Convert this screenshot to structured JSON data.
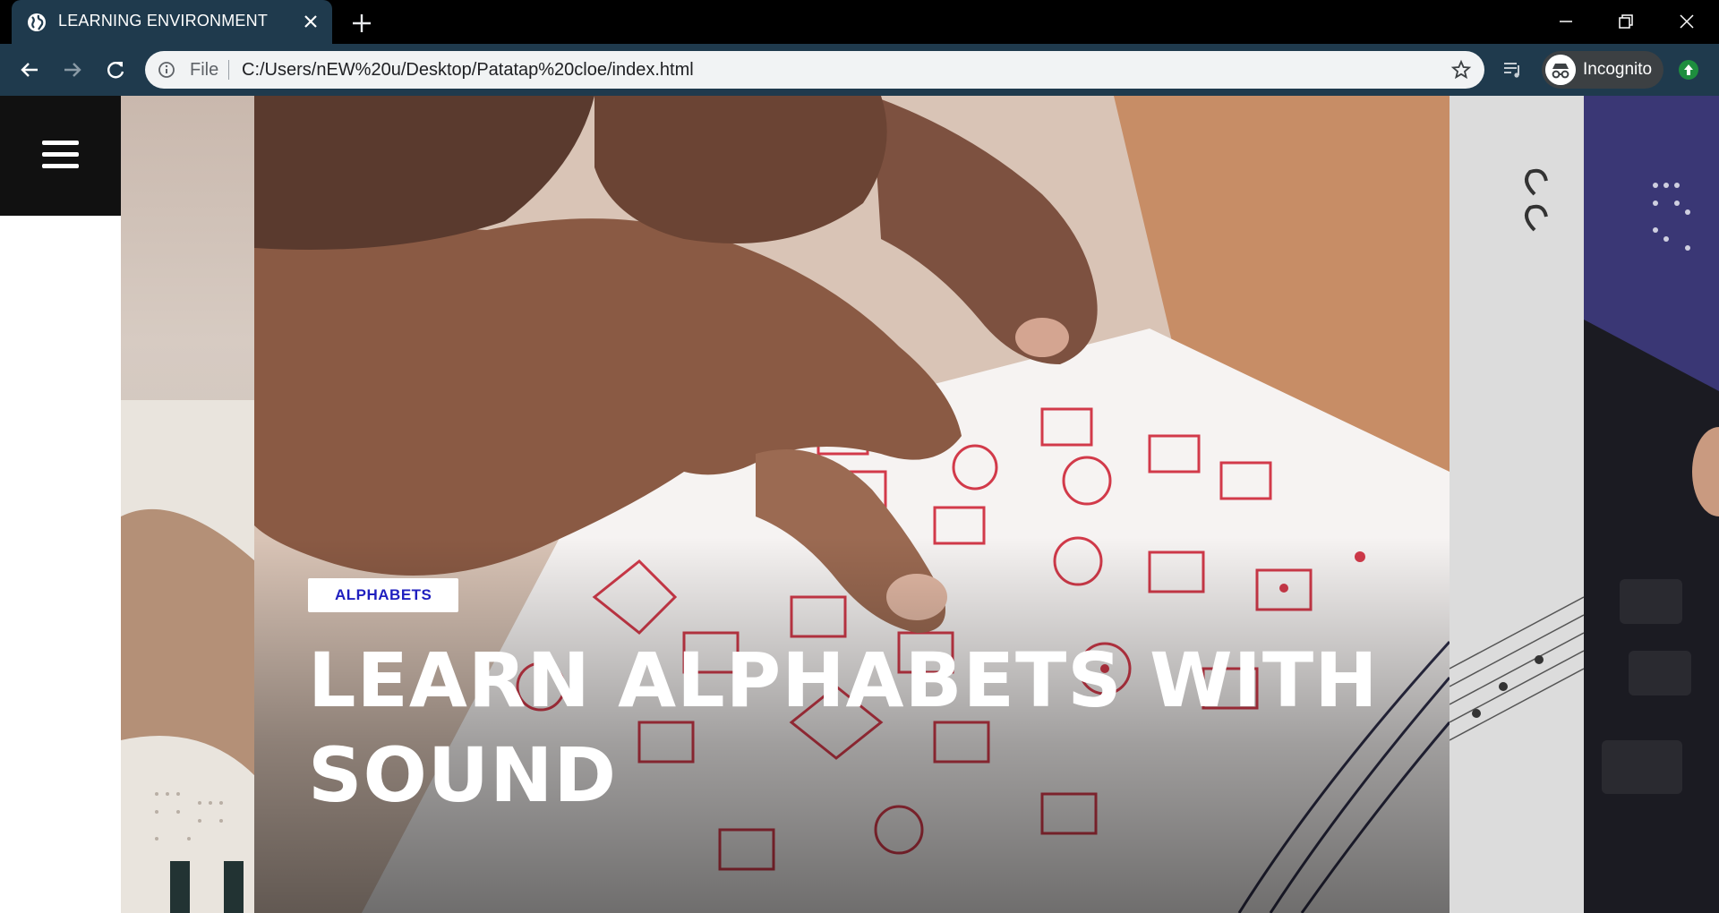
{
  "browser": {
    "tab_title": "LEARNING ENVIRONMENT",
    "url_scheme": "File",
    "url": "C:/Users/nEW%20u/Desktop/Patatap%20cloe/index.html",
    "profile_label": "Incognito",
    "accent_colors": {
      "tabbar": "#000000",
      "toolbar": "#1f3a4d",
      "omnibox": "#f1f3f4"
    }
  },
  "page": {
    "category": "ALPHABETS",
    "headline": "LEARN ALPHABETS WITH SOUND",
    "category_color": "#1f1fbf"
  }
}
